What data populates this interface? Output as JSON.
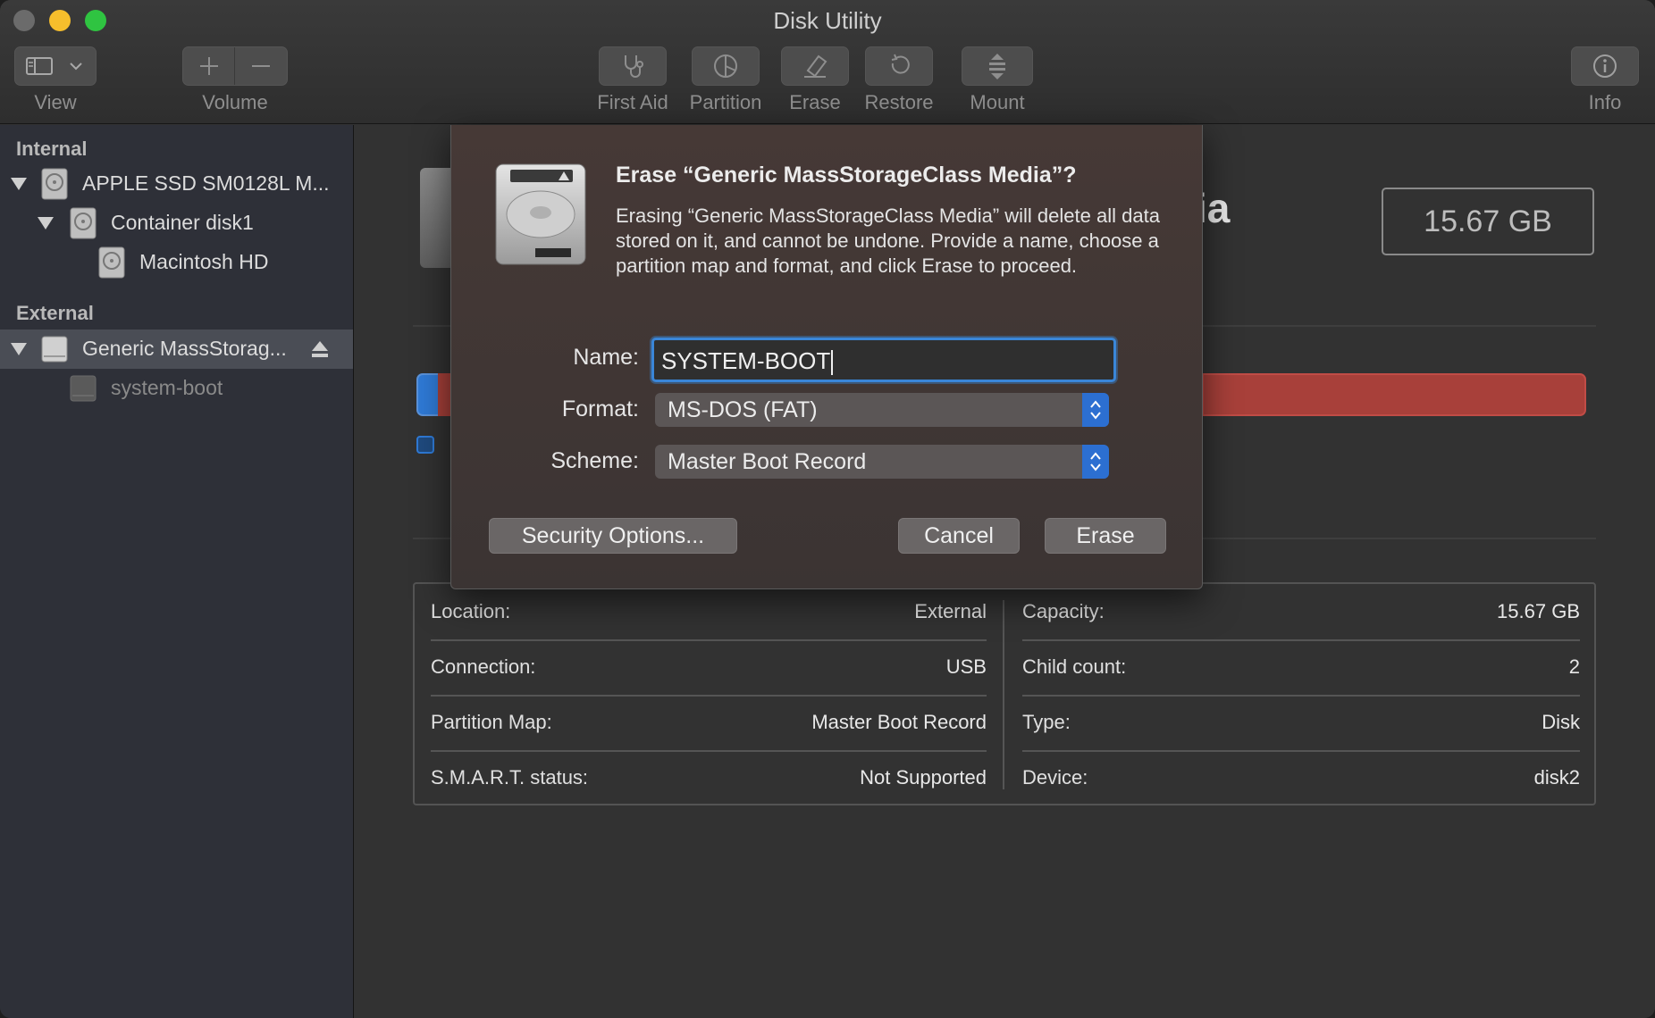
{
  "window": {
    "title": "Disk Utility"
  },
  "toolbar": {
    "view_label": "View",
    "volume_label": "Volume",
    "first_aid_label": "First Aid",
    "partition_label": "Partition",
    "erase_label": "Erase",
    "restore_label": "Restore",
    "mount_label": "Mount",
    "info_label": "Info"
  },
  "sidebar": {
    "internal_header": "Internal",
    "external_header": "External",
    "items": [
      {
        "label": "APPLE SSD SM0128L M..."
      },
      {
        "label": "Container disk1"
      },
      {
        "label": "Macintosh HD"
      },
      {
        "label": "Generic MassStorag..."
      },
      {
        "label": "system-boot"
      }
    ]
  },
  "main": {
    "title_fragment": "ia",
    "capacity_box": "15.67 GB",
    "info": {
      "left": [
        {
          "label": "Location:",
          "value": "External"
        },
        {
          "label": "Connection:",
          "value": "USB"
        },
        {
          "label": "Partition Map:",
          "value": "Master Boot Record"
        },
        {
          "label": "S.M.A.R.T. status:",
          "value": "Not Supported"
        }
      ],
      "right": [
        {
          "label": "Capacity:",
          "value": "15.67 GB"
        },
        {
          "label": "Child count:",
          "value": "2"
        },
        {
          "label": "Type:",
          "value": "Disk"
        },
        {
          "label": "Device:",
          "value": "disk2"
        }
      ]
    }
  },
  "dialog": {
    "title": "Erase “Generic MassStorageClass Media”?",
    "body": "Erasing “Generic MassStorageClass Media” will delete all data stored on it, and cannot be undone. Provide a name, choose a partition map and format, and click Erase to proceed.",
    "name_label": "Name:",
    "name_value": "SYSTEM-BOOT",
    "format_label": "Format:",
    "format_value": "MS-DOS (FAT)",
    "scheme_label": "Scheme:",
    "scheme_value": "Master Boot Record",
    "security_button": "Security Options...",
    "cancel_button": "Cancel",
    "erase_button": "Erase"
  },
  "colors": {
    "accent": "#2c6fd1",
    "partition_red": "#a8403a",
    "sidebar_bg": "#2e3038"
  }
}
